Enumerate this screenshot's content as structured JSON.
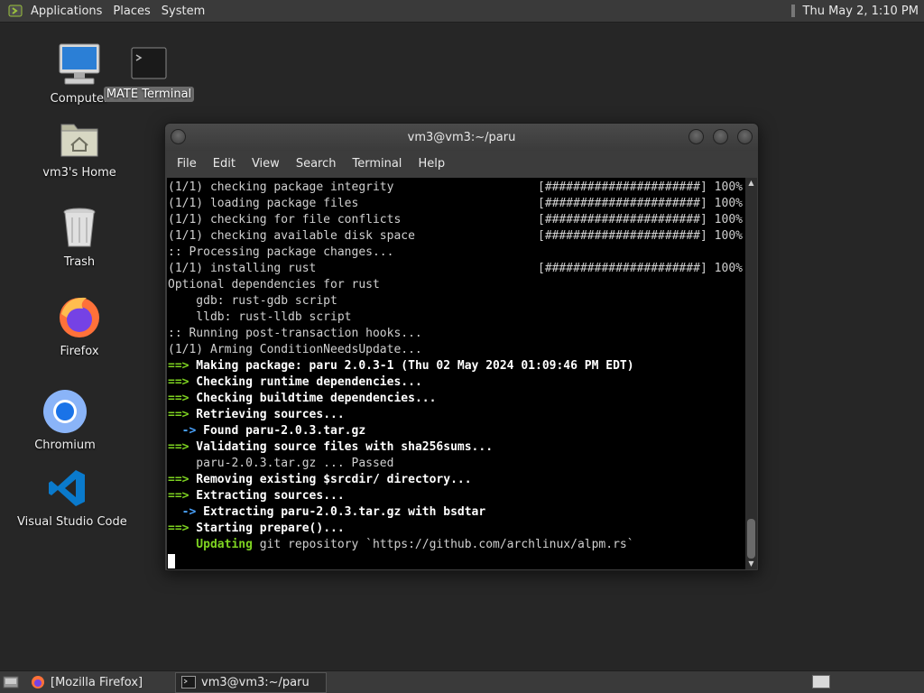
{
  "top_panel": {
    "menus": [
      "Applications",
      "Places",
      "System"
    ],
    "clock": "Thu May  2,  1:10 PM",
    "menu_icon": "mate-logo-icon"
  },
  "desktop_icons": [
    {
      "label": "Computer",
      "icon": "computer-icon"
    },
    {
      "label": "MATE Terminal",
      "icon": "terminal-icon"
    },
    {
      "label": "vm3's Home",
      "icon": "home-folder-icon"
    },
    {
      "label": "Trash",
      "icon": "trash-icon"
    },
    {
      "label": "Firefox",
      "icon": "firefox-icon"
    },
    {
      "label": "Chromium",
      "icon": "chromium-icon"
    },
    {
      "label": "Visual Studio Code",
      "icon": "vscode-icon"
    }
  ],
  "window": {
    "title": "vm3@vm3:~/paru",
    "menu": [
      "File",
      "Edit",
      "View",
      "Search",
      "Terminal",
      "Help"
    ]
  },
  "terminal": {
    "progress_text": "[######################] 100%",
    "lines": [
      {
        "text": "(1/1) checking package integrity",
        "progress": true
      },
      {
        "text": "(1/1) loading package files",
        "progress": true
      },
      {
        "text": "(1/1) checking for file conflicts",
        "progress": true
      },
      {
        "text": "(1/1) checking available disk space",
        "progress": true
      },
      {
        "text": ":: Processing package changes..."
      },
      {
        "text": "(1/1) installing rust",
        "progress": true
      },
      {
        "text": "Optional dependencies for rust"
      },
      {
        "text": "    gdb: rust-gdb script"
      },
      {
        "text": "    lldb: rust-lldb script"
      },
      {
        "text": ":: Running post-transaction hooks..."
      },
      {
        "text": "(1/1) Arming ConditionNeedsUpdate..."
      },
      {
        "arrow": "==>",
        "text": " Making package: paru 2.0.3-1 (Thu 02 May 2024 01:09:46 PM EDT)"
      },
      {
        "arrow": "==>",
        "text": " Checking runtime dependencies..."
      },
      {
        "arrow": "==>",
        "text": " Checking buildtime dependencies..."
      },
      {
        "arrow": "==>",
        "text": " Retrieving sources..."
      },
      {
        "sub": "  ->",
        "text": " Found paru-2.0.3.tar.gz"
      },
      {
        "arrow": "==>",
        "text": " Validating source files with sha256sums..."
      },
      {
        "text": "    paru-2.0.3.tar.gz ... Passed"
      },
      {
        "arrow": "==>",
        "text": " Removing existing $srcdir/ directory..."
      },
      {
        "arrow": "==>",
        "text": " Extracting sources..."
      },
      {
        "sub": "  ->",
        "text": " Extracting paru-2.0.3.tar.gz with bsdtar"
      },
      {
        "arrow": "==>",
        "text": " Starting prepare()..."
      },
      {
        "updating": "    Updating",
        "text": " git repository `https://github.com/archlinux/alpm.rs`"
      }
    ]
  },
  "taskbar": {
    "tasks": [
      {
        "label": "[Mozilla Firefox]",
        "icon": "firefox-icon"
      },
      {
        "label": "vm3@vm3:~/paru",
        "icon": "terminal-icon"
      }
    ]
  }
}
